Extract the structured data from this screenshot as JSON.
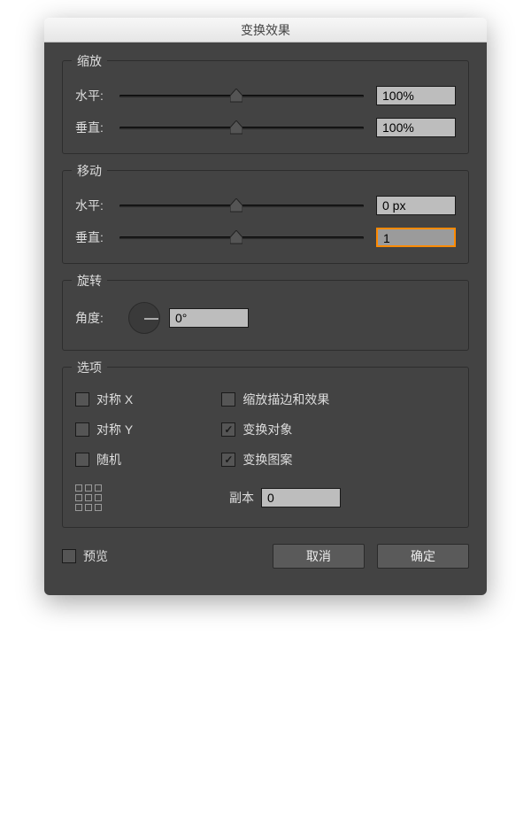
{
  "title": "变换效果",
  "scale": {
    "title": "缩放",
    "hLabel": "水平:",
    "hValue": "100%",
    "hThumbPct": 48,
    "vLabel": "垂直:",
    "vValue": "100%",
    "vThumbPct": 48
  },
  "move": {
    "title": "移动",
    "hLabel": "水平:",
    "hValue": "0 px",
    "hThumbPct": 48,
    "vLabel": "垂直:",
    "vValue": "1",
    "vThumbPct": 48,
    "vFocused": true
  },
  "rotate": {
    "title": "旋转",
    "angleLabel": "角度:",
    "angleValue": "0°"
  },
  "options": {
    "title": "选项",
    "reflectX": {
      "label": "对称 X",
      "checked": false
    },
    "reflectY": {
      "label": "对称 Y",
      "checked": false
    },
    "random": {
      "label": "随机",
      "checked": false
    },
    "scaleStrokes": {
      "label": "缩放描边和效果",
      "checked": false
    },
    "transformObjects": {
      "label": "变换对象",
      "checked": true
    },
    "transformPatterns": {
      "label": "变换图案",
      "checked": true
    },
    "copiesLabel": "副本",
    "copiesValue": "0"
  },
  "footer": {
    "preview": {
      "label": "预览",
      "checked": false
    },
    "cancel": "取消",
    "ok": "确定"
  }
}
